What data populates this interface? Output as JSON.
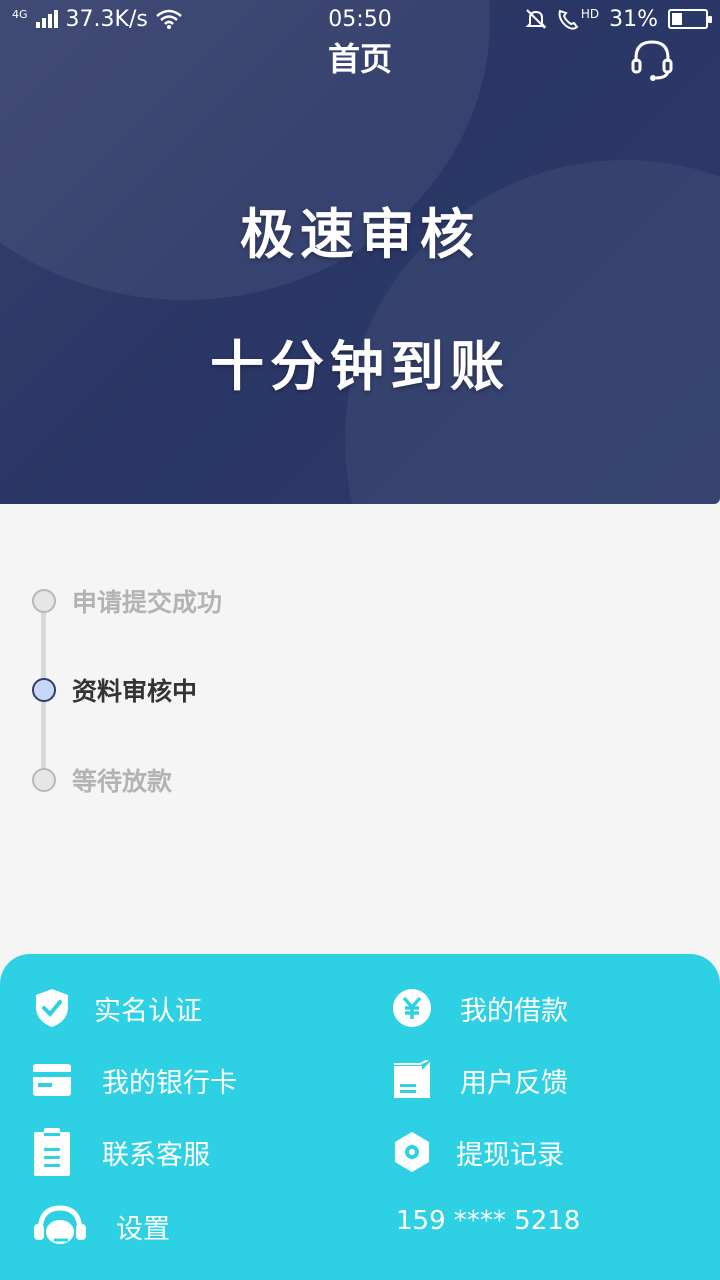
{
  "status_bar": {
    "network_type": "4G",
    "speed": "37.3K/s",
    "time": "05:50",
    "hd_label": "HD",
    "battery_percent": "31%",
    "battery_level": 0.31
  },
  "header": {
    "title": "首页",
    "customer_service_icon": "headset-icon"
  },
  "banner": {
    "line1": "极速审核",
    "line2": "十分钟到账"
  },
  "progress": {
    "steps": [
      {
        "label": "申请提交成功",
        "state": "done"
      },
      {
        "label": "资料审核中",
        "state": "active"
      },
      {
        "label": "等待放款",
        "state": "pending"
      }
    ]
  },
  "menu": {
    "items": [
      {
        "label": "实名认证",
        "icon": "shield-check-icon"
      },
      {
        "label": "我的借款",
        "icon": "yuan-coin-icon"
      },
      {
        "label": "我的银行卡",
        "icon": "bank-card-icon"
      },
      {
        "label": "用户反馈",
        "icon": "feedback-note-icon"
      },
      {
        "label": "联系客服",
        "icon": "clipboard-icon"
      },
      {
        "label": "提现记录",
        "icon": "hexagon-icon"
      },
      {
        "label": "设置",
        "icon": "headset-icon"
      }
    ],
    "phone": "159 **** 5218"
  },
  "colors": {
    "hero_bg": "#2a3766",
    "menu_bg": "#2ed1e4",
    "active_dot": "#c9d6f7",
    "inactive_text": "#b3b3b3"
  }
}
